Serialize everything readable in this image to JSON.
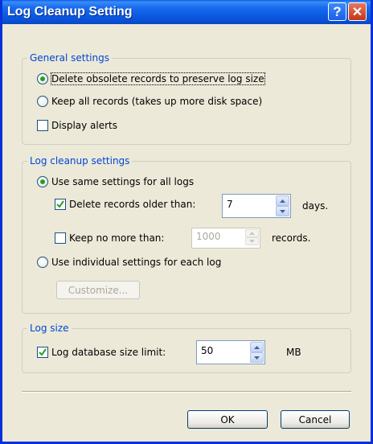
{
  "window": {
    "title": "Log Cleanup Setting",
    "help_glyph": "?",
    "close_glyph": "✕"
  },
  "general": {
    "legend": "General settings",
    "opt_delete_obsolete": "Delete obsolete records to preserve log size",
    "opt_keep_all": "Keep all records (takes up more disk space)",
    "display_alerts": "Display alerts",
    "selected": "delete_obsolete",
    "display_alerts_checked": false
  },
  "cleanup": {
    "legend": "Log cleanup settings",
    "opt_same": "Use same settings for all logs",
    "delete_older_label": "Delete records older than:",
    "delete_older_value": "7",
    "delete_older_unit": "days.",
    "delete_older_checked": true,
    "keep_no_more_label": "Keep no more than:",
    "keep_no_more_value": "1000",
    "keep_no_more_unit": "records.",
    "keep_no_more_checked": false,
    "opt_individual": "Use individual settings for each log",
    "customize_label": "Customize...",
    "selected": "same"
  },
  "size": {
    "legend": "Log size",
    "limit_label": "Log database size limit:",
    "limit_value": "50",
    "limit_unit": "MB",
    "limit_checked": true
  },
  "buttons": {
    "ok": "OK",
    "cancel": "Cancel"
  }
}
